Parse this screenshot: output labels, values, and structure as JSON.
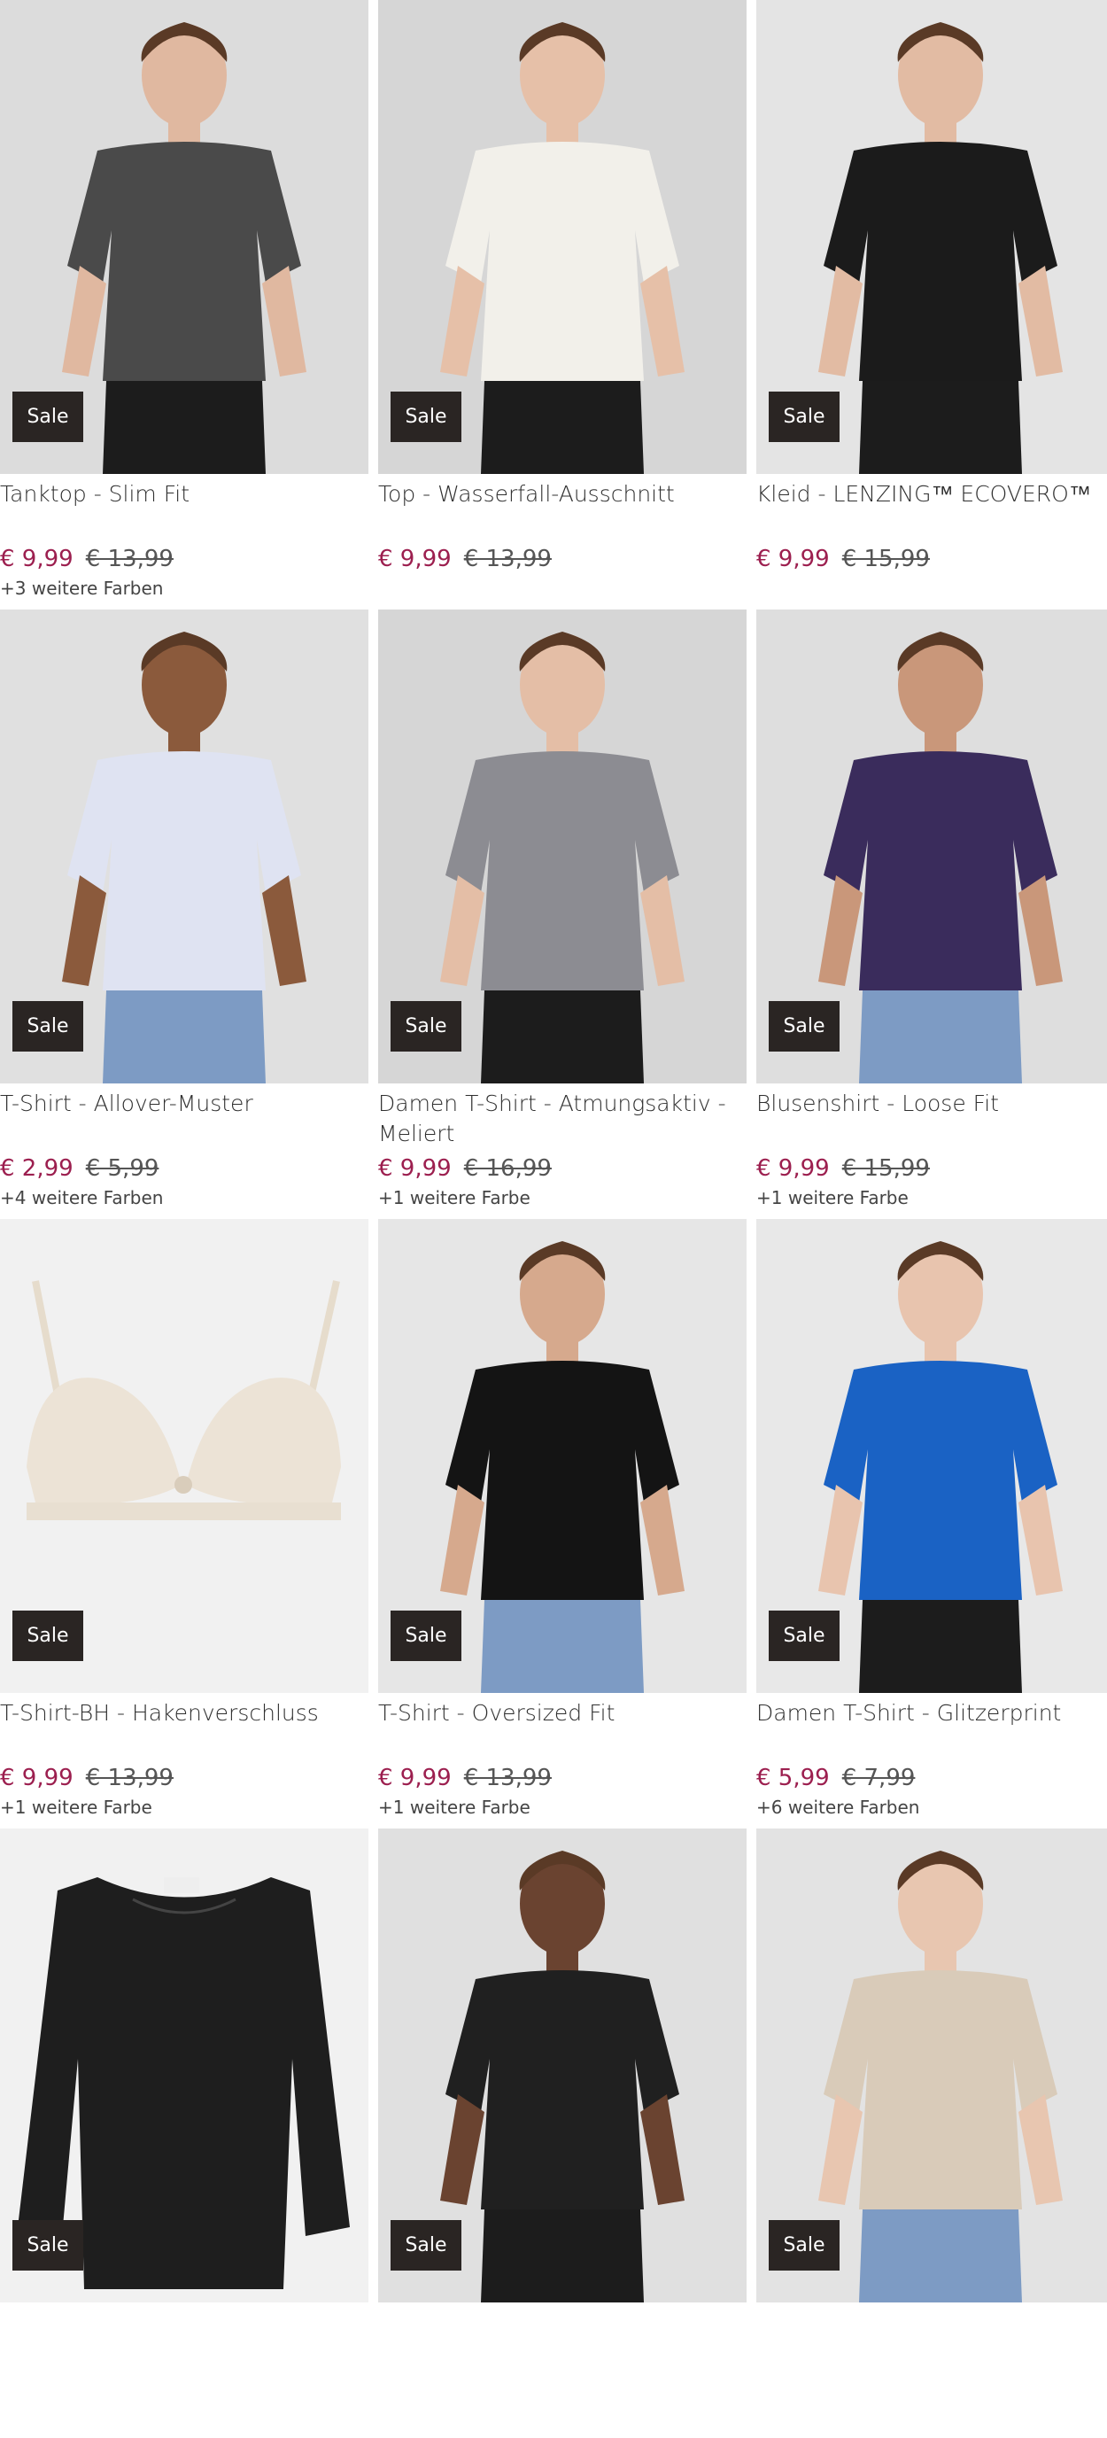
{
  "products": [
    {
      "name": "Tanktop - Slim Fit",
      "badge": "Sale",
      "price": "€ 9,99",
      "old_price": "€ 13,99",
      "colors": "+3 weitere Farben",
      "bg": "#dcdcdc",
      "garment": "#4a4a4a",
      "skin": "#e0b8a0"
    },
    {
      "name": "Top - Wasserfall-Ausschnitt",
      "badge": "Sale",
      "price": "€ 9,99",
      "old_price": "€ 13,99",
      "colors": "",
      "bg": "#d6d6d6",
      "garment": "#f2f0ea",
      "skin": "#e6c0a8"
    },
    {
      "name": "Kleid - LENZING™ ECOVERO™",
      "badge": "Sale",
      "price": "€ 9,99",
      "old_price": "€ 15,99",
      "colors": "",
      "bg": "#e4e4e4",
      "garment": "#1b1b1b",
      "skin": "#e2bba3"
    },
    {
      "name": "T-Shirt - Allover-Muster",
      "badge": "Sale",
      "price": "€ 2,99",
      "old_price": "€ 5,99",
      "colors": "+4 weitere Farben",
      "bg": "#e0e0e0",
      "garment": "#dfe3f2",
      "skin": "#8b5a3c"
    },
    {
      "name": "Damen T-Shirt - Atmungsaktiv - Meliert",
      "badge": "Sale",
      "price": "€ 9,99",
      "old_price": "€ 16,99",
      "colors": "+1 weitere Farbe",
      "bg": "#d6d6d6",
      "garment": "#8c8c92",
      "skin": "#e4bea6"
    },
    {
      "name": "Blusenshirt - Loose Fit",
      "badge": "Sale",
      "price": "€ 9,99",
      "old_price": "€ 15,99",
      "colors": "+1 weitere Farbe",
      "bg": "#dedede",
      "garment": "#3a2c5c",
      "skin": "#c9977a"
    },
    {
      "name": "T-Shirt-BH - Hakenverschluss",
      "badge": "Sale",
      "price": "€ 9,99",
      "old_price": "€ 13,99",
      "colors": "+1 weitere Farbe",
      "bg": "#f1f1f1",
      "garment": "#ece3d6",
      "skin": "#ece3d6"
    },
    {
      "name": "T-Shirt - Oversized Fit",
      "badge": "Sale",
      "price": "€ 9,99",
      "old_price": "€ 13,99",
      "colors": "+1 weitere Farbe",
      "bg": "#e6e6e6",
      "garment": "#141414",
      "skin": "#d6a98d"
    },
    {
      "name": "Damen T-Shirt - Glitzerprint",
      "badge": "Sale",
      "price": "€ 5,99",
      "old_price": "€ 7,99",
      "colors": "+6 weitere Farben",
      "bg": "#e8e8e8",
      "garment": "#1a62c4",
      "skin": "#e8c4ae"
    },
    {
      "name": "",
      "badge": "Sale",
      "price": "",
      "old_price": "",
      "colors": "",
      "bg": "#f1f1f1",
      "garment": "#1e1e1e",
      "skin": "#f1f1f1"
    },
    {
      "name": "",
      "badge": "Sale",
      "price": "",
      "old_price": "",
      "colors": "",
      "bg": "#e0e0e0",
      "garment": "#202020",
      "skin": "#6a4330"
    },
    {
      "name": "",
      "badge": "Sale",
      "price": "",
      "old_price": "",
      "colors": "",
      "bg": "#e3e3e3",
      "garment": "#d9cbb9",
      "skin": "#e8c6b0"
    }
  ]
}
